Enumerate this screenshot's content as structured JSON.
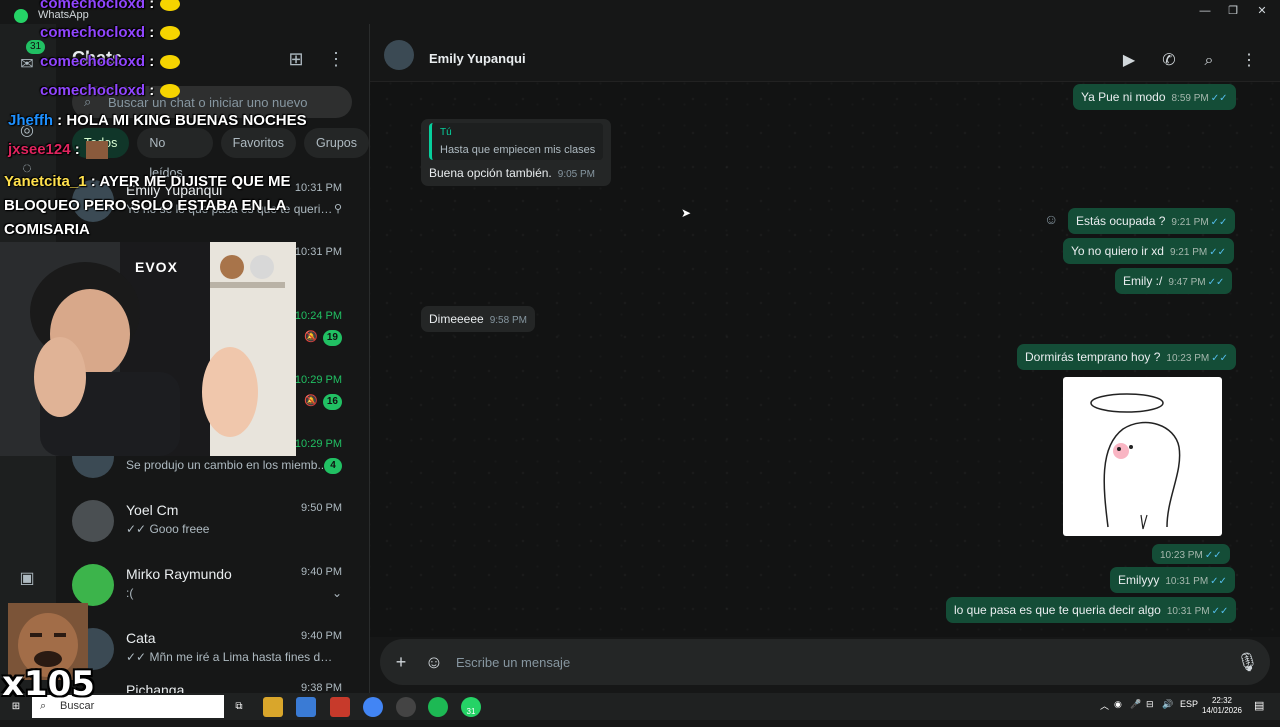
{
  "window": {
    "title": "WhatsApp",
    "controls": [
      "—",
      "❐",
      "✕"
    ]
  },
  "rail": {
    "badge": "31"
  },
  "chatlist": {
    "title": "Chats",
    "search_placeholder": "Buscar un chat o iniciar uno nuevo",
    "filters": [
      "Todos",
      "No leídos",
      "Favoritos",
      "Grupos"
    ],
    "rows": [
      {
        "name": "Emily Yupanqui",
        "preview": "Yo no sé lo que pasa es que te queria dec...",
        "time": "10:31 PM",
        "unread": false,
        "badge": "",
        "pinned": true,
        "muted": false
      },
      {
        "name": "",
        "preview": "",
        "time": "10:31 PM",
        "unread": false,
        "badge": "",
        "pinned": false,
        "muted": false
      },
      {
        "name": "",
        "preview": "",
        "time": "10:24 PM",
        "unread": true,
        "badge": "19",
        "pinned": false,
        "muted": true
      },
      {
        "name": "",
        "preview": "",
        "time": "10:29 PM",
        "unread": true,
        "badge": "16",
        "pinned": false,
        "muted": true
      },
      {
        "name": "",
        "preview": "Se produjo un cambio en los miemb...",
        "time": "10:29 PM",
        "unread": true,
        "badge": "4",
        "pinned": false,
        "muted": false
      },
      {
        "name": "Yoel Cm",
        "preview": "✓✓ Gooo freee",
        "time": "9:50 PM",
        "unread": false,
        "badge": "",
        "pinned": false,
        "muted": false
      },
      {
        "name": "Mirko Raymundo",
        "preview": ":(",
        "time": "9:40 PM",
        "unread": false,
        "badge": "",
        "pinned": false,
        "muted": false,
        "chevron": true
      },
      {
        "name": "Cata",
        "preview": "✓✓ Mñn me iré a Lima hasta fines de e...",
        "time": "9:40 PM",
        "unread": false,
        "badge": "",
        "pinned": false,
        "muted": false
      },
      {
        "name": "Pichanga",
        "preview": "",
        "time": "9:38 PM",
        "unread": false,
        "badge": "",
        "pinned": false,
        "muted": false
      }
    ]
  },
  "conversation": {
    "contact_name": "Emily Yupanqui",
    "messages": [
      {
        "dir": "out",
        "text": "Ya Pue ni modo",
        "time": "8:59 PM"
      },
      {
        "dir": "in",
        "quote_name": "Tú",
        "quote_text": "Hasta que empiecen mis clases",
        "text": "Buena opción también.",
        "time": "9:05 PM"
      },
      {
        "dir": "out",
        "text": "Estás ocupada ?",
        "time": "9:21 PM"
      },
      {
        "dir": "out",
        "text": "Yo no quiero ir xd",
        "time": "9:21 PM"
      },
      {
        "dir": "out",
        "text": "Emily :/",
        "time": "9:47 PM"
      },
      {
        "dir": "in",
        "text": "Dimeeeee",
        "time": "9:58 PM"
      },
      {
        "dir": "out",
        "text": "Dormirás temprano hoy ?",
        "time": "10:23 PM"
      },
      {
        "dir": "out",
        "text": "",
        "time": "10:23 PM",
        "sticker": true
      },
      {
        "dir": "out",
        "text": "Emilyyy",
        "time": "10:31 PM"
      },
      {
        "dir": "out",
        "text": "lo que pasa es que te queria decir algo",
        "time": "10:31 PM"
      }
    ],
    "composer_placeholder": "Escribe un mensaje"
  },
  "taskbar": {
    "search_label": "Buscar",
    "whatsapp_badge": "31",
    "language": "ESP",
    "clock_time": "22:32",
    "clock_date": "14/01/2026"
  },
  "overlay": {
    "chat": [
      {
        "user": "comechocloxd",
        "sep": " :",
        "text": "",
        "emote": "lemon"
      },
      {
        "user": "comechocloxd",
        "sep": " :",
        "text": "",
        "emote": "lemon"
      },
      {
        "user": "comechocloxd",
        "sep": " :",
        "text": "",
        "emote": "lemon"
      },
      {
        "user": "comechocloxd",
        "sep": " :",
        "text": "",
        "emote": "lemon"
      },
      {
        "user": "Jheffh",
        "sep": " :",
        "text": "HOLA MI KING BUENAS NOCHES"
      },
      {
        "user": "jxsee124",
        "sep": " :",
        "text": ""
      },
      {
        "user": "Yanetcita_1",
        "sep": " :",
        "text": "AYER ME DIJISTE QUE ME BLOQUEO PERO SOLO ESTABA EN LA COMISARIA"
      }
    ],
    "combo_text": "x105",
    "webcam_logo": "EVOX"
  }
}
